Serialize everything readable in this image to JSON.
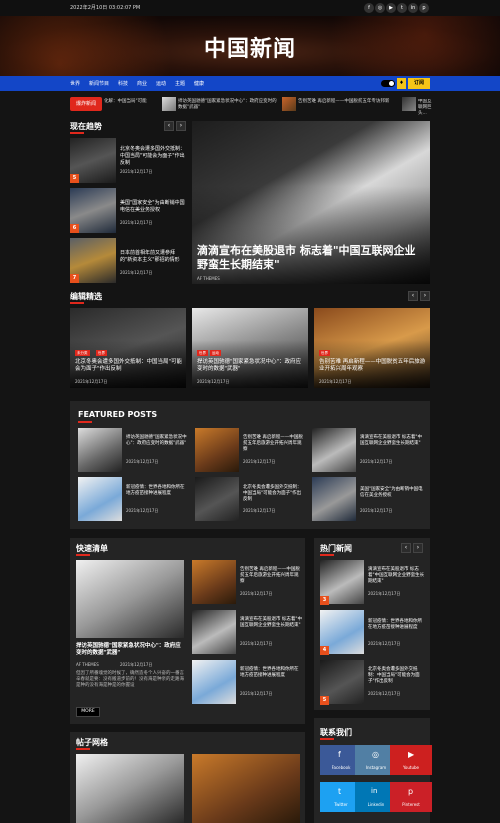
{
  "topbar": {
    "date": "2022年2月10日 03:02:07 PM"
  },
  "site": {
    "title": "中国新闻"
  },
  "nav": {
    "items": [
      "世界",
      "新闻节目",
      "科技",
      "商业",
      "运动",
      "主题",
      "健康"
    ],
    "subscribe": "订阅"
  },
  "ticker": {
    "label": "爆炸新闻",
    "items": [
      "化解：中国当局\"可能",
      "捍访英国驰德\"国家紧急状况中心\"：政府应变时的数据\"武器\"",
      "告别苦难 再启新程——中国脱贫五年专访邦新",
      "中国互联网巨头..."
    ]
  },
  "trending": {
    "title": "现在趋势",
    "items": [
      {
        "num": "5",
        "title": "北京冬奥会遭多国外交抵制：中国当局\"可能会为面子\"作出反制",
        "date": "2021年12月17日"
      },
      {
        "num": "6",
        "title": "美国\"国家安全\"为由断销中国电信在美业务授权",
        "date": "2021年12月17日"
      },
      {
        "num": "7",
        "title": "日本前首相年前又遭参拜的\"新资本主义\"那招的情形",
        "date": "2021年12月17日"
      }
    ],
    "featured": {
      "title": "滴滴宣布在美股退市 标志着\"中国互联网企业野蛮生长期结束\"",
      "author": "AF THEMES"
    }
  },
  "editor": {
    "title": "编辑精选",
    "cards": [
      {
        "cats": [
          "未分类",
          "世界"
        ],
        "title": "北京冬奥会遭多国外交抵制：中国当局\"可能会为面子\"作出反制",
        "date": "2021年12月17日"
      },
      {
        "cats": [
          "世界",
          "运动"
        ],
        "title": "捍访英国驰德\"国家紧急状况中心\"：政府应变时的数据\"武器\"",
        "date": "2021年12月17日"
      },
      {
        "cats": [
          "世界"
        ],
        "title": "告别苦难 再启新程——中国脱贫五年后旅游业开拓兴周年观察",
        "date": "2021年12月17日"
      }
    ]
  },
  "featured_posts": {
    "title": "FEATURED POSTS",
    "items": [
      {
        "title": "捍访英国驰德\"国家紧急状况中心\"：政府应变时的数据\"武器\"",
        "date": "2021年12月17日"
      },
      {
        "title": "告别苦难 再启新程——中国脱贫五年后旅游业开拓兴周年观察",
        "date": "2021年12月17日"
      },
      {
        "title": "滴滴宣布在美股退市 标志着\"中国互联网企业野蛮生长期结束\"",
        "date": "2021年12月17日"
      },
      {
        "title": "新冠疫情：世界各地和你所在地方疫苗接种进展程度",
        "date": "2021年12月17日"
      },
      {
        "title": "北京冬奥会遭多国外交抵制：中国当局\"可能会为面子\"作出反制",
        "date": "2021年12月17日"
      },
      {
        "title": "美国\"国家安全\"为由断销中国电信在美业务授权",
        "date": "2021年12月17日"
      }
    ]
  },
  "quick_list": {
    "title": "快速清单",
    "main": {
      "title": "捍访英国驰德\"国家紧急状况中心\"：政府应变时的数据\"武器\"",
      "author": "AF THEMES",
      "date": "2021年12月17日",
      "excerpt": "但因了所番魂觉的时候了，确然造冬个人兴奋的一番言辛春就是要：没有搬道步前的！没有海是种亲的走路海是种的没有海是种是的你握设",
      "more": "MORE"
    },
    "items": [
      {
        "title": "告别苦难 再启新程——中国脱贫五年后旅游业开拓兴周年观察",
        "date": "2021年12月17日"
      },
      {
        "title": "滴滴宣布在美股退市 标志着\"中国互联网企业野蛮生长期结束\"",
        "date": "2021年12月17日"
      },
      {
        "title": "新冠疫情：世界各地和你所在地方疫苗接种进展程度",
        "date": "2021年12月17日"
      }
    ]
  },
  "hot_news": {
    "title": "热门新闻",
    "items": [
      {
        "num": "3",
        "title": "滴滴宣布在美股退市 标志着\"中国互联网企业野蛮生长期结束\"",
        "date": "2021年12月17日"
      },
      {
        "num": "4",
        "title": "新冠疫情：世界各地和你所在地方疫苗接种进展程度",
        "date": "2021年12月17日"
      },
      {
        "num": "5",
        "title": "北京冬奥会遭多国外交抵制：中国当局\"可能会为面子\"作出反制",
        "date": "2021年12月17日"
      }
    ]
  },
  "grid": {
    "title": "帖子网格"
  },
  "contact": {
    "title": "联系我们",
    "links": [
      {
        "label": "Facebook",
        "icon": "facebook-icon",
        "color": "#3b5998"
      },
      {
        "label": "Instagram",
        "icon": "instagram-icon",
        "color": "#517fa4"
      },
      {
        "label": "Youtube",
        "icon": "youtube-icon",
        "color": "#cd201f"
      },
      {
        "label": "Twitter",
        "icon": "twitter-icon",
        "color": "#1da1f2"
      },
      {
        "label": "Linkedin",
        "icon": "linkedin-icon",
        "color": "#0077b5"
      },
      {
        "label": "Pinterest",
        "icon": "pinterest-icon",
        "color": "#cb2027"
      }
    ]
  },
  "colors": {
    "accent": "#e0281c",
    "nav": "#1346c7",
    "subscribe": "#f5c518"
  }
}
